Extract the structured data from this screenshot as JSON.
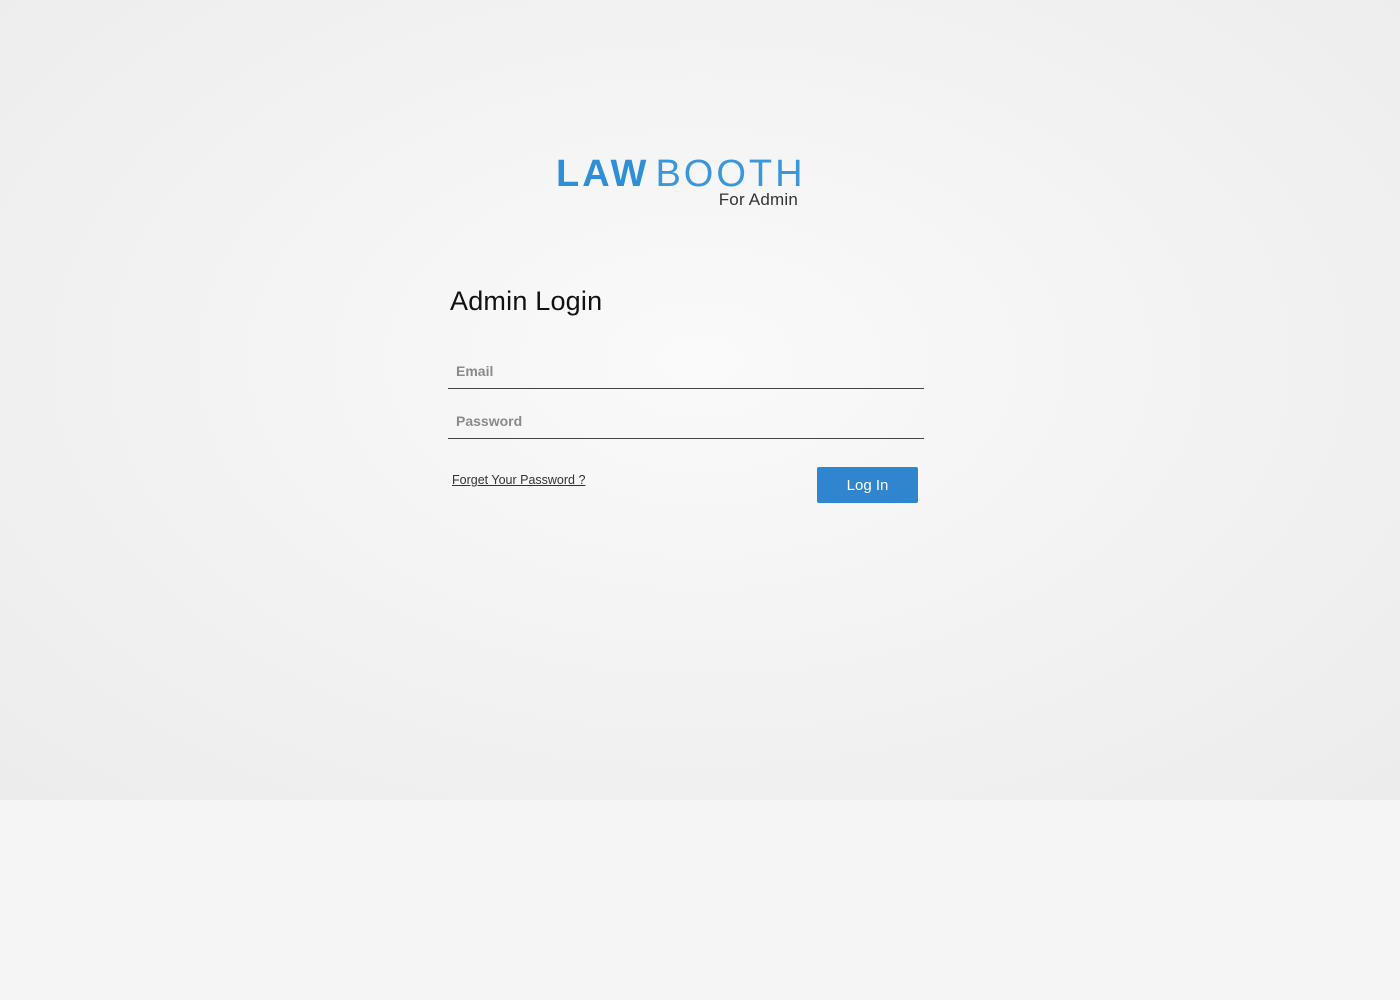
{
  "brand": {
    "name_bold": "LAW",
    "name_light": "BOOTH",
    "tagline": "For Admin",
    "color": "#2f8fd6"
  },
  "login": {
    "title": "Admin Login",
    "email_placeholder": "Email",
    "password_placeholder": "Password",
    "forgot_link": "Forget Your Password ?",
    "submit_label": "Log In",
    "button_color": "#2f86cf"
  }
}
